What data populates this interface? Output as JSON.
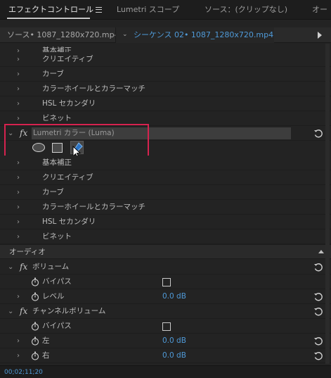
{
  "tabs": [
    {
      "label": "エフェクトコントロール",
      "active": true
    },
    {
      "label": "Lumetri スコープ",
      "active": false
    },
    {
      "label": "ソース：(クリップなし)",
      "active": false
    },
    {
      "label": "オー",
      "active": false
    }
  ],
  "source_bar": {
    "clip": "ソース• 1087_1280x720.mp4",
    "sequence": "シーケンス 02• 1087_1280x720.mp4"
  },
  "effect_rows_top": [
    {
      "label": "基本補正"
    },
    {
      "label": "クリエイティブ"
    },
    {
      "label": "カーブ"
    },
    {
      "label": "カラーホイールとカラーマッチ"
    },
    {
      "label": "HSL セカンダリ"
    },
    {
      "label": "ビネット"
    }
  ],
  "lumetri_effect": {
    "fx_symbol": "fx",
    "name": "Lumetri カラー (Luma)",
    "mask_tools": [
      "ellipse-mask-icon",
      "rectangle-mask-icon",
      "pen-mask-icon"
    ]
  },
  "effect_rows_bottom": [
    {
      "label": "基本補正"
    },
    {
      "label": "クリエイティブ"
    },
    {
      "label": "カーブ"
    },
    {
      "label": "カラーホイールとカラーマッチ"
    },
    {
      "label": "HSL セカンダリ"
    },
    {
      "label": "ビネット"
    }
  ],
  "audio_section": {
    "label": "オーディオ"
  },
  "volume": {
    "fx_symbol": "fx",
    "name": "ボリューム",
    "bypass_label": "バイパス",
    "level_label": "レベル",
    "level_value": "0.0 dB"
  },
  "channel_volume": {
    "fx_symbol": "fx",
    "name": "チャンネルボリューム",
    "bypass_label": "バイパス",
    "left_label": "左",
    "left_value": "0.0 dB",
    "right_label": "右",
    "right_value": "0.0 dB"
  },
  "status": {
    "timecode": "00;02;11;20"
  },
  "colors": {
    "accent_blue": "#4f9ad8",
    "highlight_red": "#d6234f"
  }
}
